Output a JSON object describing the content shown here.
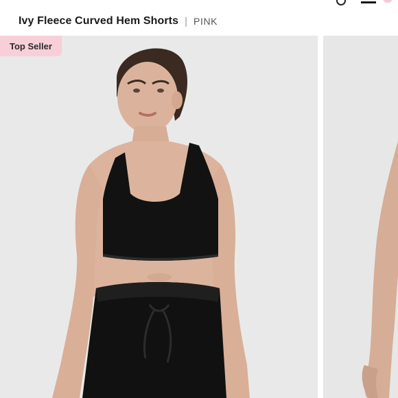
{
  "header": {
    "product_title": "Ivy Fleece Curved Hem Shorts",
    "separator": "|",
    "brand": "PINK"
  },
  "gallery": {
    "badge": "Top Seller"
  },
  "colors": {
    "badge_bg": "#f8cfd9",
    "photo_bg": "#e9e9e9"
  }
}
